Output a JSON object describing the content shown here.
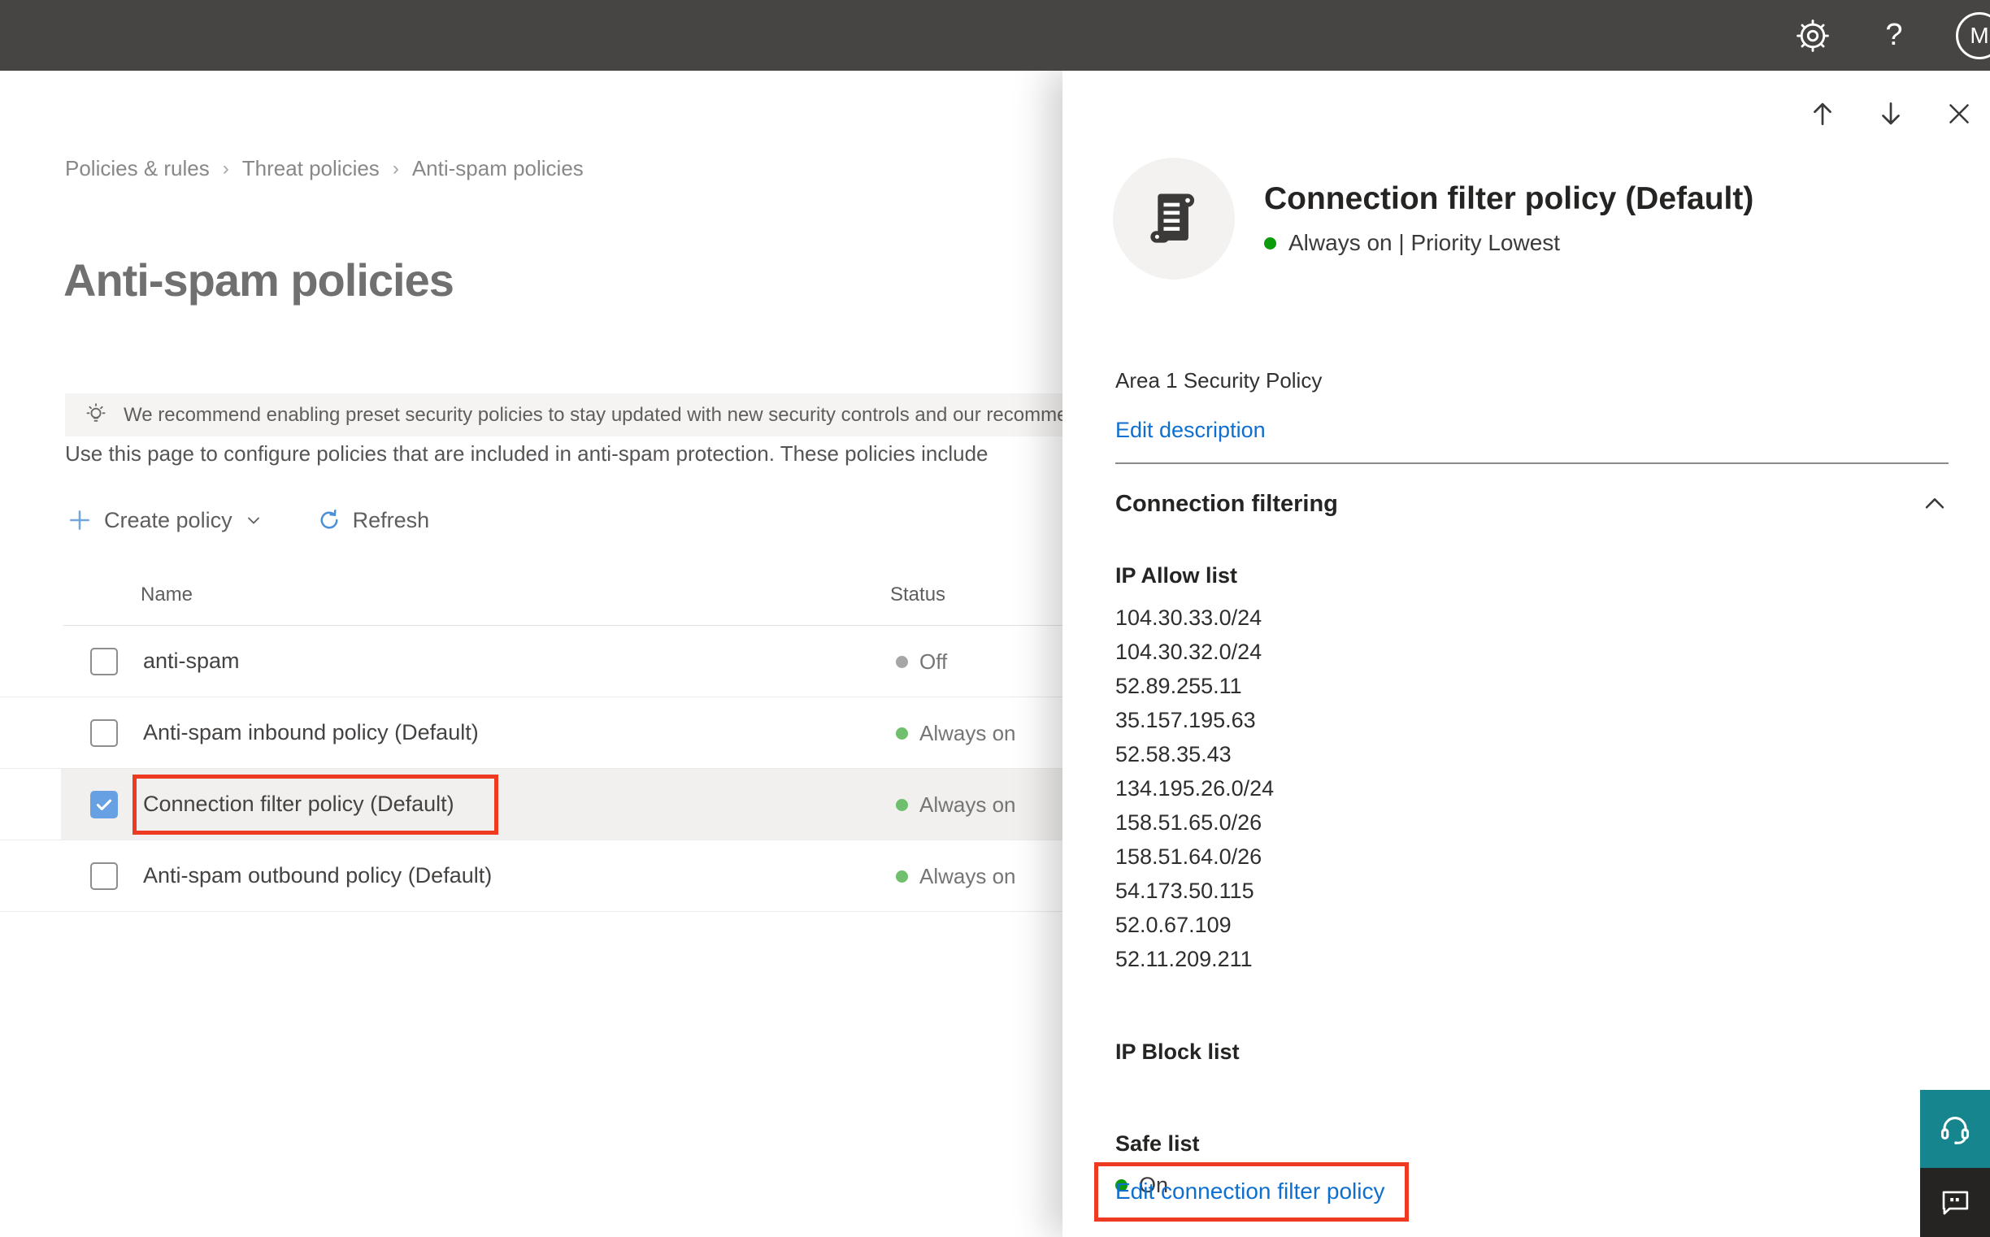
{
  "topbar": {
    "help_glyph": "?",
    "avatar_initial": "M"
  },
  "breadcrumb": {
    "items": [
      "Policies & rules",
      "Threat policies",
      "Anti-spam policies"
    ],
    "separator": "›"
  },
  "page": {
    "title": "Anti-spam policies",
    "banner_text": "We recommend enabling preset security policies to stay updated with new security controls and our recomme",
    "description": "Use this page to configure policies that are included in anti-spam protection. These policies include",
    "toolbar": {
      "create_policy_label": "Create policy",
      "refresh_label": "Refresh"
    }
  },
  "table": {
    "columns": {
      "name": "Name",
      "status": "Status"
    },
    "rows": [
      {
        "name": "anti-spam",
        "status": "Off",
        "checked": false,
        "highlighted": false
      },
      {
        "name": "Anti-spam inbound policy (Default)",
        "status": "Always on",
        "checked": false,
        "highlighted": false
      },
      {
        "name": "Connection filter policy (Default)",
        "status": "Always on",
        "checked": true,
        "highlighted": true
      },
      {
        "name": "Anti-spam outbound policy (Default)",
        "status": "Always on",
        "checked": false,
        "highlighted": false
      }
    ]
  },
  "panel": {
    "title": "Connection filter policy (Default)",
    "status_line": "Always on | Priority Lowest",
    "description": "Area 1 Security Policy",
    "edit_description_label": "Edit description",
    "section_title": "Connection filtering",
    "ip_allow": {
      "title": "IP Allow list",
      "items": [
        "104.30.33.0/24",
        "104.30.32.0/24",
        "52.89.255.11",
        "35.157.195.63",
        "52.58.35.43",
        "134.195.26.0/24",
        "158.51.65.0/26",
        "158.51.64.0/26",
        "54.173.50.115",
        "52.0.67.109",
        "52.11.209.211"
      ]
    },
    "ip_block_title": "IP Block list",
    "safe_list": {
      "title": "Safe list",
      "status": "On"
    },
    "edit_policy_label": "Edit connection filter policy"
  },
  "colors": {
    "topbar_bg": "#474543",
    "accent_blue": "#0f6fce",
    "toolbar_icon_blue": "#71a7dc",
    "refresh_icon_blue": "#4a90d9",
    "table_status_green": "#6fbf6e",
    "panel_status_green": "#0b9b0b",
    "status_off_gray": "#a6a6a6",
    "checkbox_blue": "#68a1e3",
    "annotation_red": "#ee3a21",
    "support_teal": "#17858d",
    "feedback_dark": "#252423",
    "selected_row_bg": "#f1f0ef"
  }
}
